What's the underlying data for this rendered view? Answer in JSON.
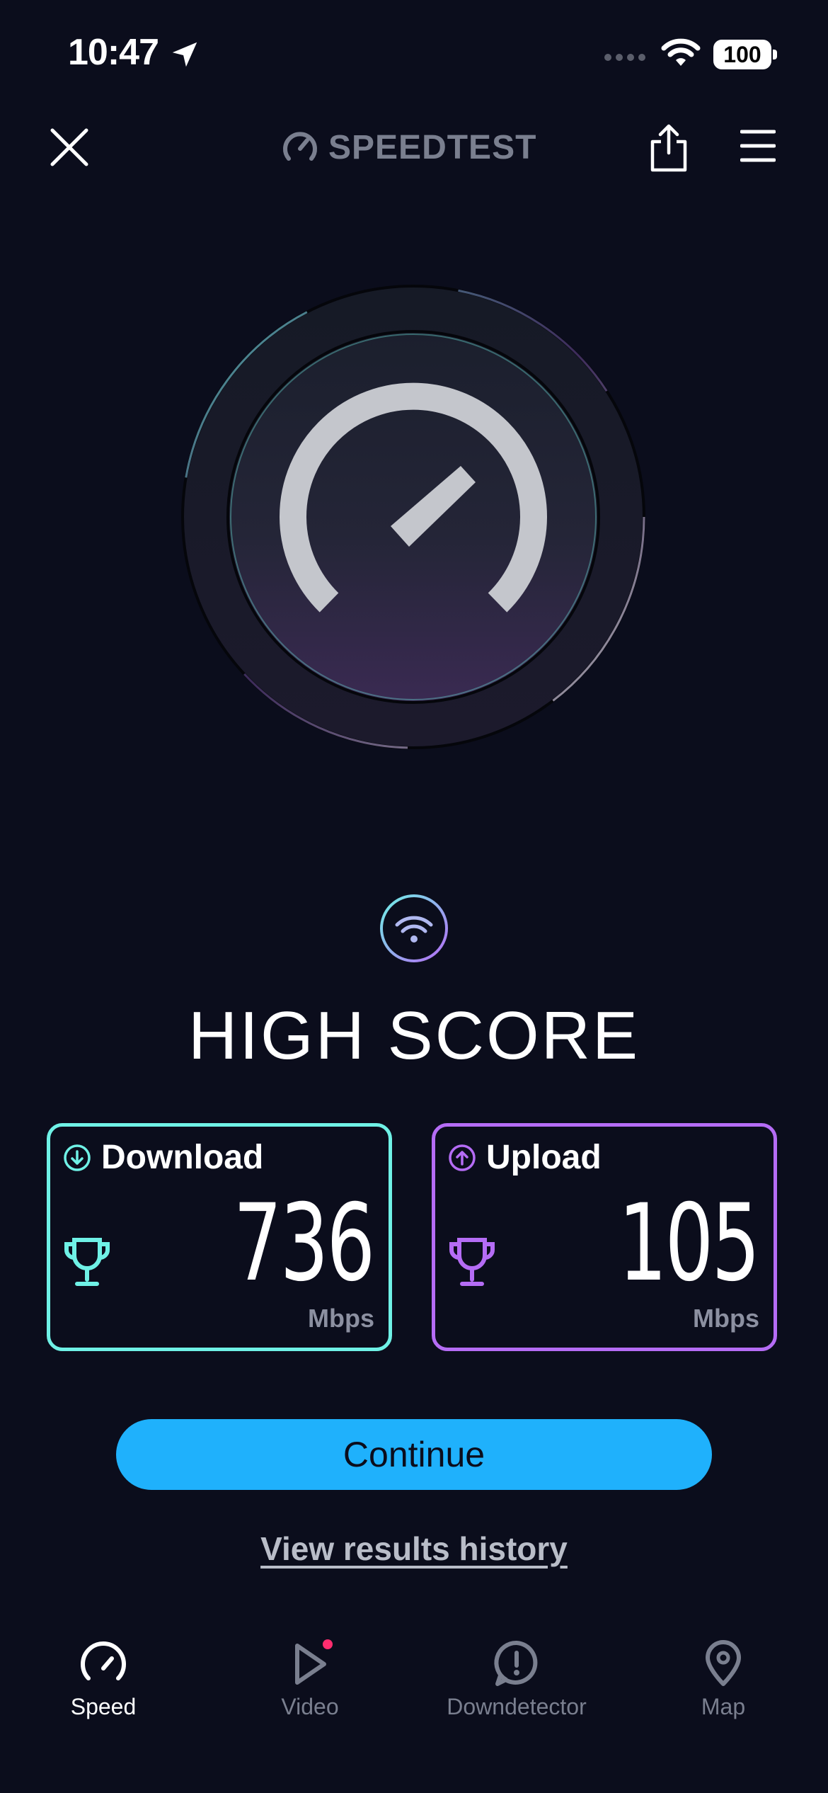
{
  "status_bar": {
    "time": "10:47",
    "battery": "100"
  },
  "header": {
    "logo_text": "SPEEDTEST"
  },
  "score": {
    "title": "HIGH SCORE"
  },
  "download": {
    "label": "Download",
    "value": "736",
    "unit": "Mbps"
  },
  "upload": {
    "label": "Upload",
    "value": "105",
    "unit": "Mbps"
  },
  "actions": {
    "continue_label": "Continue",
    "history_label": "View results history"
  },
  "tabs": [
    {
      "label": "Speed",
      "icon": "speedometer-icon",
      "active": true
    },
    {
      "label": "Video",
      "icon": "play-icon",
      "active": false,
      "badge": true
    },
    {
      "label": "Downdetector",
      "icon": "alert-icon",
      "active": false
    },
    {
      "label": "Map",
      "icon": "map-pin-icon",
      "active": false
    }
  ],
  "colors": {
    "background": "#0b0d1c",
    "download_accent": "#6ff1e6",
    "upload_accent": "#b56cf5",
    "continue_button": "#1fb1fc",
    "badge": "#ff2d6f"
  }
}
